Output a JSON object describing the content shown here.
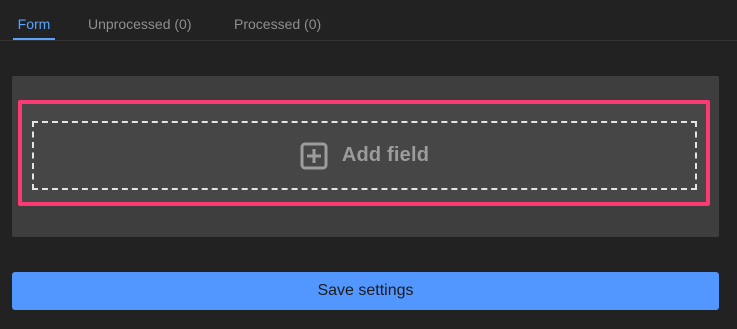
{
  "tabs": [
    {
      "label": "Form",
      "active": true
    },
    {
      "label": "Unprocessed (0)",
      "active": false
    },
    {
      "label": "Processed (0)",
      "active": false
    }
  ],
  "form": {
    "add_field_label": "Add field",
    "add_field_icon": "plus-square-icon"
  },
  "actions": {
    "save_label": "Save settings"
  },
  "colors": {
    "background": "#222222",
    "panel": "#3e3e3e",
    "accent": "#5297ff",
    "active_tab": "#5aa3ff",
    "highlight": "#ff3a72"
  }
}
